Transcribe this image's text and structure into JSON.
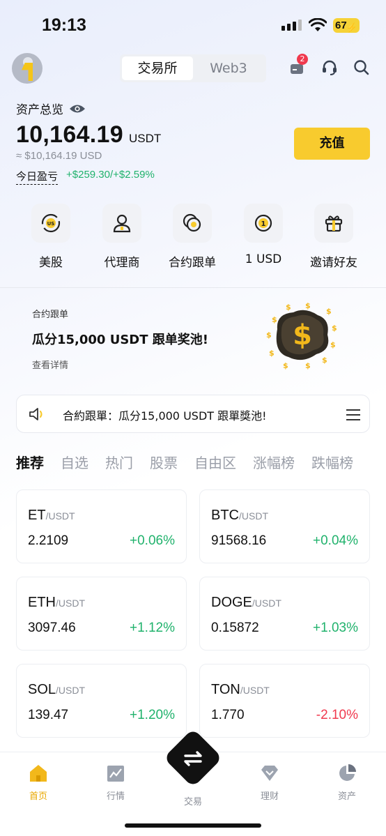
{
  "status_bar": {
    "time": "19:13",
    "battery": "67"
  },
  "header": {
    "segments": [
      "交易所",
      "Web3"
    ],
    "active_segment": 0,
    "notification_count": "2"
  },
  "assets": {
    "label": "资产总览",
    "balance": "10,164.19",
    "unit": "USDT",
    "approx": "≈ $10,164.19 USD",
    "pnl_label": "今日盈亏",
    "pnl_value": "+$259.30/+$2.59%",
    "deposit_label": "充值"
  },
  "quick_actions": [
    {
      "label": "美股",
      "icon": "us-stock-icon"
    },
    {
      "label": "代理商",
      "icon": "agent-icon"
    },
    {
      "label": "合约跟单",
      "icon": "copy-trade-icon"
    },
    {
      "label": "1 USD",
      "icon": "one-usd-icon"
    },
    {
      "label": "邀请好友",
      "icon": "gift-icon"
    }
  ],
  "promo": {
    "tag": "合约跟单",
    "title": "瓜分15,000 USDT 跟单奖池!",
    "more": "查看详情"
  },
  "notice": {
    "text": "合約跟單：瓜分15,000 USDT 跟單獎池!"
  },
  "tabs": [
    "推荐",
    "自选",
    "热门",
    "股票",
    "自由区",
    "涨幅榜",
    "跌幅榜"
  ],
  "market": [
    {
      "base": "ET",
      "quote": "/USDT",
      "price": "2.2109",
      "change": "+0.06%"
    },
    {
      "base": "BTC",
      "quote": "/USDT",
      "price": "91568.16",
      "change": "+0.04%"
    },
    {
      "base": "ETH",
      "quote": "/USDT",
      "price": "3097.46",
      "change": "+1.12%"
    },
    {
      "base": "DOGE",
      "quote": "/USDT",
      "price": "0.15872",
      "change": "+1.03%"
    },
    {
      "base": "SOL",
      "quote": "/USDT",
      "price": "139.47",
      "change": "+1.20%"
    },
    {
      "base": "TON",
      "quote": "/USDT",
      "price": "1.770",
      "change": "-2.10%"
    }
  ],
  "colors": {
    "up": "#20b26c",
    "down": "#f0394e",
    "accent": "#f8cb2e",
    "nav_active": "#e9a800"
  },
  "bottom_nav": [
    {
      "label": "首页",
      "icon": "home-icon"
    },
    {
      "label": "行情",
      "icon": "market-icon"
    },
    {
      "label": "交易",
      "icon": "trade-icon"
    },
    {
      "label": "理财",
      "icon": "finance-icon"
    },
    {
      "label": "资产",
      "icon": "assets-pie-icon"
    }
  ]
}
